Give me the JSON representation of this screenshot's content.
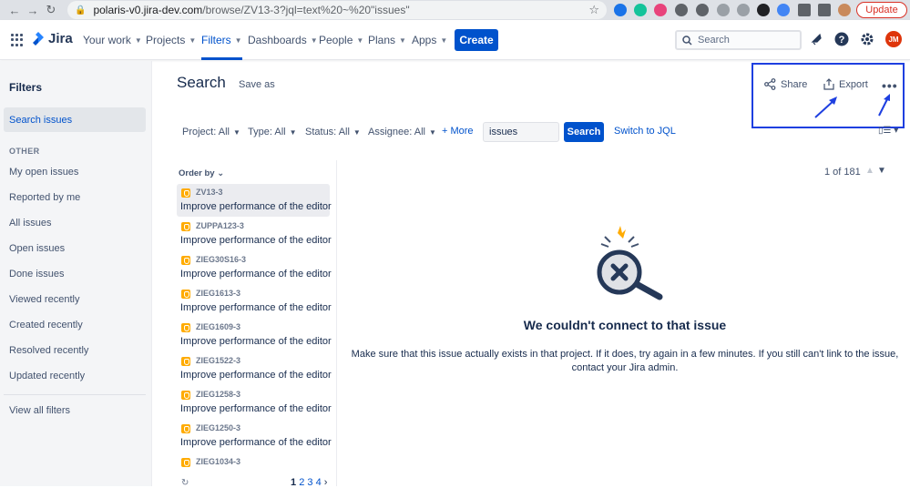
{
  "browser": {
    "url_host": "polaris-v0.jira-dev.com",
    "url_path": "/browse/ZV13-3?jql=text%20~%20\"issues\"",
    "update_label": "Update",
    "profile_initials": "JM"
  },
  "topnav": {
    "product": "Jira",
    "items": [
      "Your work",
      "Projects",
      "Filters",
      "Dashboards",
      "People",
      "Plans",
      "Apps"
    ],
    "active_item": "Filters",
    "create_label": "Create",
    "search_placeholder": "Search",
    "avatar_initials": "JM",
    "colors": {
      "brand": "#0052cc",
      "avatar": "#de350b"
    }
  },
  "sidebar": {
    "title": "Filters",
    "active_item": "Search issues",
    "section_label": "OTHER",
    "items": [
      "My open issues",
      "Reported by me",
      "All issues",
      "Open issues",
      "Done issues",
      "Viewed recently",
      "Created recently",
      "Resolved recently",
      "Updated recently"
    ],
    "footer_item": "View all filters"
  },
  "header": {
    "title": "Search",
    "save_as": "Save as",
    "share": "Share",
    "export": "Export"
  },
  "filters": {
    "project": "Project: All",
    "type": "Type: All",
    "status": "Status: All",
    "assignee": "Assignee: All",
    "more": "+ More",
    "text_value": "issues",
    "search_button": "Search",
    "switch_jql": "Switch to JQL"
  },
  "list": {
    "order_by": "Order by",
    "issues": [
      {
        "key": "ZV13-3",
        "summary": "Improve performance of the editor"
      },
      {
        "key": "ZUPPA123-3",
        "summary": "Improve performance of the editor"
      },
      {
        "key": "ZIEG30S16-3",
        "summary": "Improve performance of the editor"
      },
      {
        "key": "ZIEG1613-3",
        "summary": "Improve performance of the editor"
      },
      {
        "key": "ZIEG1609-3",
        "summary": "Improve performance of the editor"
      },
      {
        "key": "ZIEG1522-3",
        "summary": "Improve performance of the editor"
      },
      {
        "key": "ZIEG1258-3",
        "summary": "Improve performance of the editor"
      },
      {
        "key": "ZIEG1250-3",
        "summary": "Improve performance of the editor"
      },
      {
        "key": "ZIEG1034-3",
        "summary": ""
      }
    ],
    "pages": [
      "1",
      "2",
      "3",
      "4"
    ],
    "current_page": "1"
  },
  "detail": {
    "pager": "1 of 181",
    "error_title": "We couldn't connect to that issue",
    "error_body": "Make sure that this issue actually exists in that project. If it does, try again in a few minutes. If you still can't link to the issue, contact your Jira admin."
  },
  "annotation": {
    "highlight_color": "#1e3fe0"
  }
}
